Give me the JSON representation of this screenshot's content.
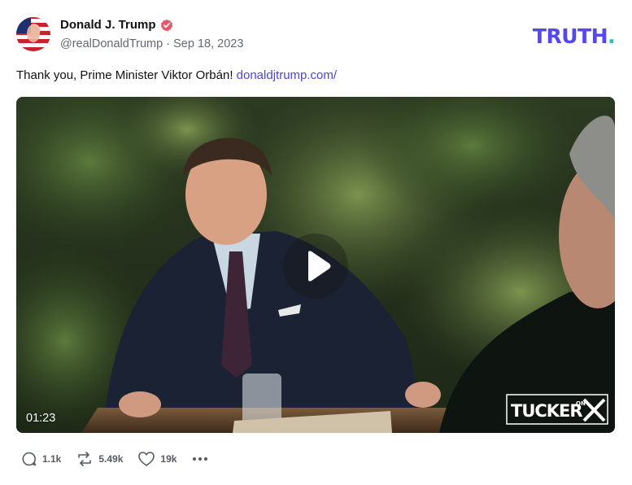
{
  "author": {
    "display_name": "Donald J. Trump",
    "handle": "@realDonaldTrump",
    "separator": "·",
    "date": "Sep 18, 2023",
    "verified_icon": "verified-badge-icon"
  },
  "brand": {
    "logo_text": "TRUTH",
    "logo_dot": ".",
    "accent": "#5448ee",
    "dot_color": "#17c9b3"
  },
  "post": {
    "text": "Thank you, Prime Minister Viktor Orbán!",
    "link_text": "donaldjtrump.com/"
  },
  "video": {
    "duration": "01:23",
    "play_icon": "play-icon",
    "watermark_text": "TUCKER",
    "watermark_small": "ON",
    "watermark_x": "X"
  },
  "actions": {
    "replies": "1.1k",
    "retruths": "5.49k",
    "likes": "19k",
    "more_icon": "more-icon"
  }
}
